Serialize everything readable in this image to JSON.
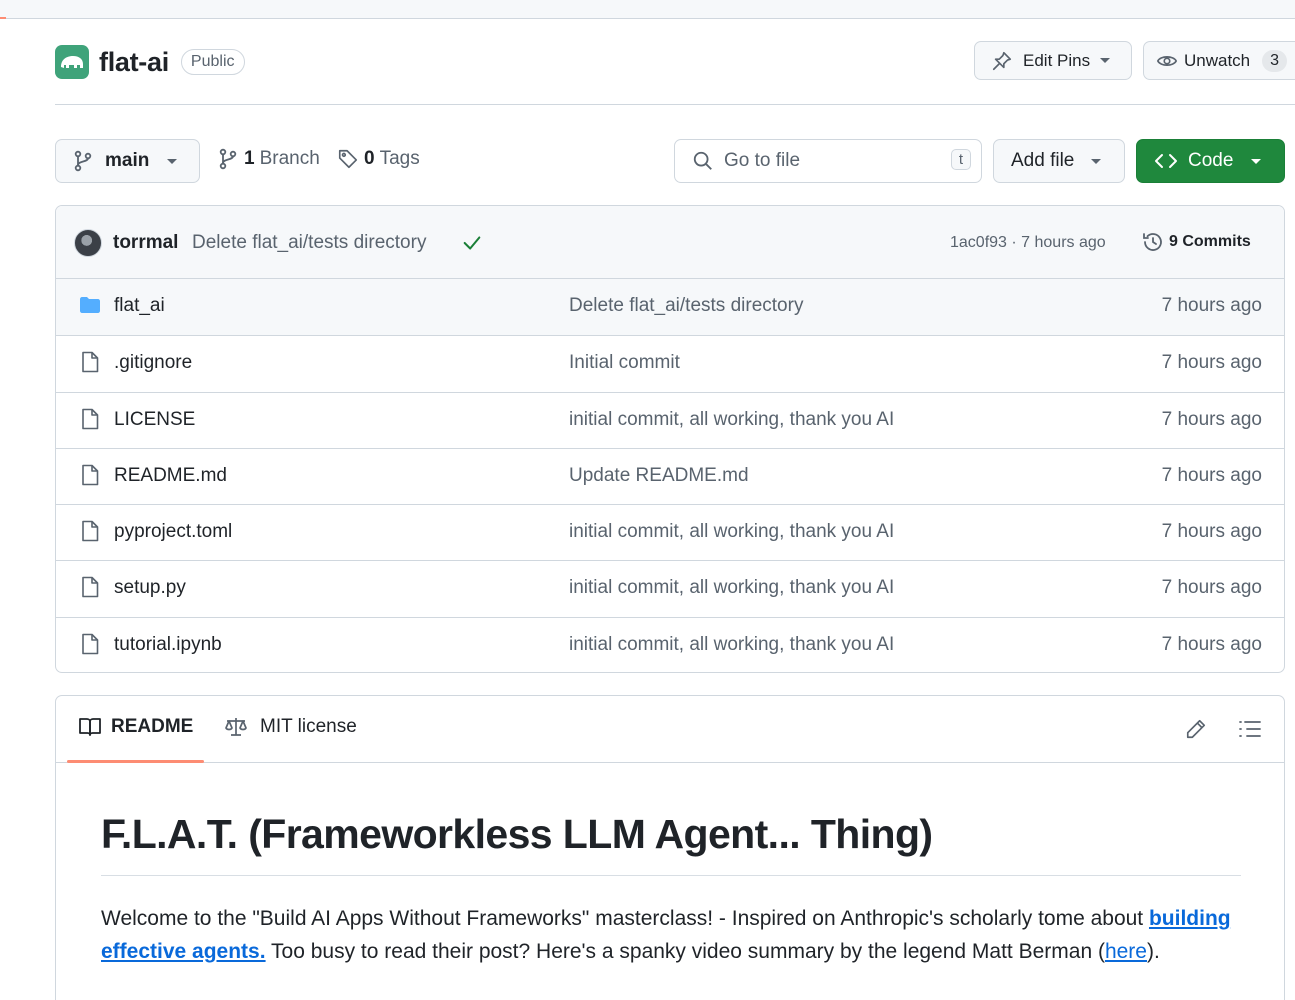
{
  "repo": {
    "name": "flat-ai",
    "visibility": "Public"
  },
  "actions": {
    "edit_pins": "Edit Pins",
    "unwatch": "Unwatch",
    "watch_count": "3"
  },
  "toolbar": {
    "branch": "main",
    "branch_count": "1",
    "branch_label": "Branch",
    "tag_count": "0",
    "tag_label": "Tags",
    "search_placeholder": "Go to file",
    "search_shortcut": "t",
    "add_file": "Add file",
    "code": "Code"
  },
  "latest_commit": {
    "author": "torrmal",
    "message": "Delete flat_ai/tests directory",
    "hash_time": "1ac0f93 · 7 hours ago",
    "commits": "9 Commits"
  },
  "files": [
    {
      "name": "flat_ai",
      "type": "folder",
      "message": "Delete flat_ai/tests directory",
      "age": "7 hours ago"
    },
    {
      "name": ".gitignore",
      "type": "file",
      "message": "Initial commit",
      "age": "7 hours ago"
    },
    {
      "name": "LICENSE",
      "type": "file",
      "message": "initial commit, all working, thank you AI",
      "age": "7 hours ago"
    },
    {
      "name": "README.md",
      "type": "file",
      "message": "Update README.md",
      "age": "7 hours ago"
    },
    {
      "name": "pyproject.toml",
      "type": "file",
      "message": "initial commit, all working, thank you AI",
      "age": "7 hours ago"
    },
    {
      "name": "setup.py",
      "type": "file",
      "message": "initial commit, all working, thank you AI",
      "age": "7 hours ago"
    },
    {
      "name": "tutorial.ipynb",
      "type": "file",
      "message": "initial commit, all working, thank you AI",
      "age": "7 hours ago"
    }
  ],
  "readme": {
    "tab_readme": "README",
    "tab_license": "MIT license",
    "title": "F.L.A.T. (Frameworkless LLM Agent... Thing)",
    "p_part1": "Welcome to the \"Build AI Apps Without Frameworks\" masterclass! - Inspired on Anthropic's scholarly tome about ",
    "p_link1": "building effective agents.",
    "p_part2": " Too busy to read their post? Here's a spanky video summary by the legend Matt Berman (",
    "p_link2": "here",
    "p_part3": ")."
  },
  "colors": {
    "accent": "#fd8c73",
    "code_button": "#1f883d",
    "link": "#0969da",
    "folder": "#54aeff",
    "check": "#1a7f37"
  },
  "icons": [
    "pin-icon",
    "eye-icon",
    "branch-icon",
    "tag-icon",
    "search-icon",
    "code-icon",
    "check-icon",
    "history-icon",
    "folder-icon",
    "file-icon",
    "book-icon",
    "scale-icon",
    "pencil-icon",
    "list-icon"
  ]
}
